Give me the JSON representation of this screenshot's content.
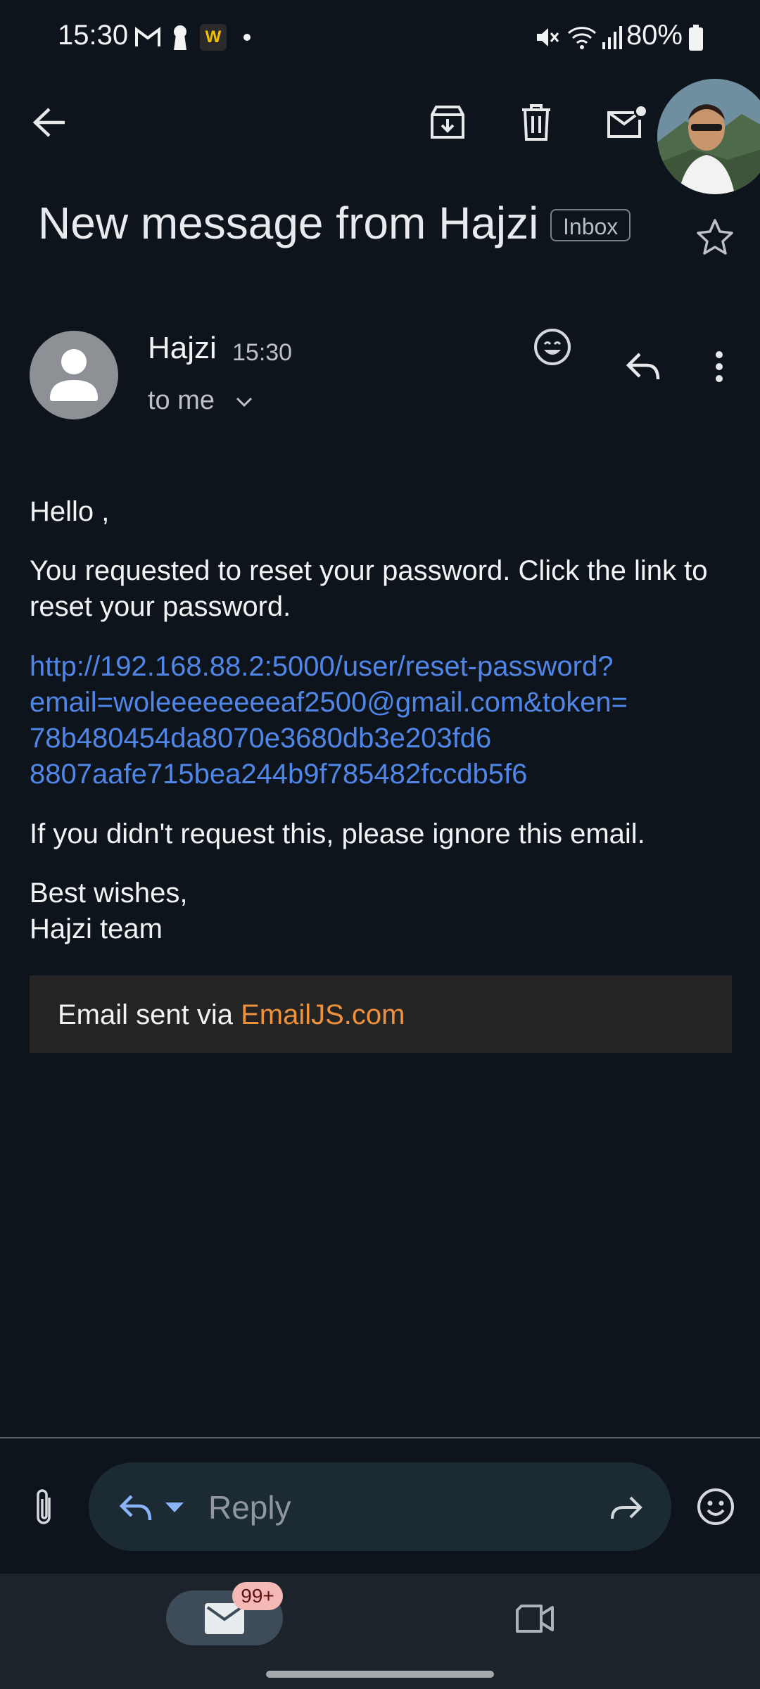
{
  "status_bar": {
    "time": "15:30",
    "battery": "80%",
    "notif_app_label": "W"
  },
  "toolbar": {
    "back_icon": "arrow-left-icon",
    "archive_icon": "archive-icon",
    "delete_icon": "trash-icon",
    "mark_unread_icon": "mail-unread-icon"
  },
  "subject": {
    "title": "New message from Hajzi",
    "label": "Inbox"
  },
  "message": {
    "sender": "Hajzi",
    "time": "15:30",
    "recipient": "to me",
    "greeting": "Hello ,",
    "paragraph": "You requested to reset your password. Click the link to reset your password.",
    "link_lines": [
      "http://192.168.88.2:5000/user/reset-password?",
      "email=woleeeeeeeeaf2500@gmail.com&token=",
      "78b480454da8070e3680db3e203fd6",
      "8807aafe715bea244b9f785482fccdb5f6"
    ],
    "ignore_note": "If you didn't request this, please ignore this email.",
    "signoff": "Best wishes,",
    "signature": "Hajzi team",
    "footer_prefix": "Email sent via ",
    "footer_brand": "EmailJS.com"
  },
  "reply": {
    "placeholder": "Reply"
  },
  "bottom_nav": {
    "mail_badge": "99+"
  },
  "colors": {
    "background": "#0e141b",
    "link": "#4f86e8",
    "brand": "#f0913c",
    "reply_accent": "#8ab4f8"
  }
}
